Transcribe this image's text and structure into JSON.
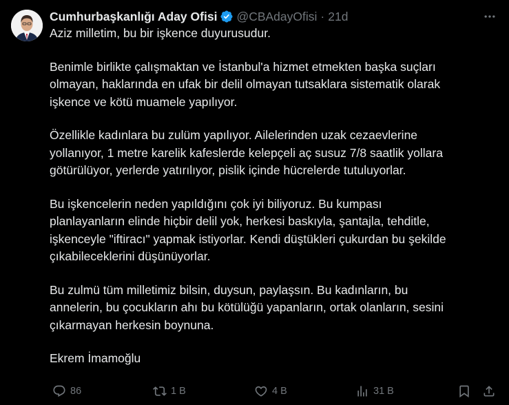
{
  "tweet": {
    "display_name": "Cumhurbaşkanlığı Aday Ofisi",
    "handle": "@CBAdayOfisi",
    "separator": "·",
    "time": "21d",
    "paragraphs": [
      [
        "Aziz milletim, bu bir işkence duyurusudur."
      ],
      [
        "Benimle birlikte çalışmaktan ve İstanbul'a hizmet etmekten başka suçları",
        "olmayan, haklarında en ufak bir delil olmayan tutsaklara sistematik olarak",
        "işkence ve kötü muamele yapılıyor."
      ],
      [
        "Özellikle kadınlara bu zulüm yapılıyor. Ailelerinden uzak cezaevlerine",
        "yollanıyor, 1 metre karelik kafeslerde kelepçeli aç susuz 7/8 saatlik yollara",
        "götürülüyor, yerlerde yatırılıyor, pislik içinde hücrelerde tutuluyorlar."
      ],
      [
        "Bu işkencelerin neden yapıldığını çok iyi biliyoruz. Bu kumpası",
        "planlayanların elinde hiçbir delil yok, herkesi baskıyla, şantajla, tehditle,",
        "işkenceyle \"iftiracı\" yapmak istiyorlar. Kendi düştükleri çukurdan bu şekilde",
        "çıkabileceklerini düşünüyorlar."
      ],
      [
        "Bu zulmü tüm milletimiz bilsin, duysun, paylaşsın. Bu kadınların, bu",
        "annelerin, bu çocukların ahı bu kötülüğü yapanların, ortak olanların, sesini",
        "çıkarmayan herkesin boynuna."
      ],
      [
        "Ekrem İmamoğlu"
      ]
    ]
  },
  "actions": {
    "replies": "86",
    "reposts": "1 B",
    "likes": "4 B",
    "views": "31 B"
  },
  "icons": {
    "verified": "verified-badge-icon",
    "more": "more-icon",
    "reply": "reply-icon",
    "repost": "repost-icon",
    "like": "heart-icon",
    "views": "views-icon",
    "bookmark": "bookmark-icon",
    "share": "share-icon"
  },
  "colors": {
    "background": "#000000",
    "text": "#e7e9ea",
    "muted": "#71767b",
    "verified": "#1d9bf0"
  }
}
